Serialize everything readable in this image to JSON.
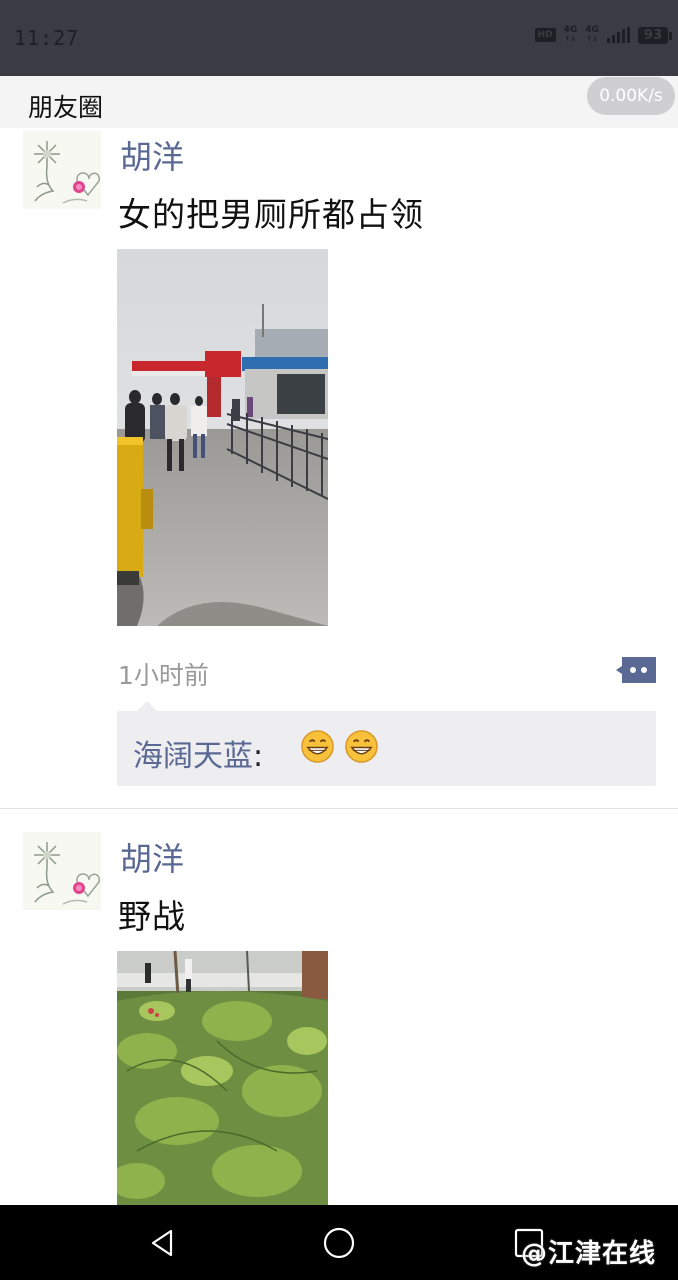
{
  "status_bar": {
    "time": "11:27",
    "hd": "HD",
    "net1": "4G",
    "net2": "4G",
    "battery": "93"
  },
  "header": {
    "title": "朋友圈",
    "speed": "0.00K/s"
  },
  "posts": [
    {
      "author": "胡洋",
      "text": "女的把男厕所都占领",
      "time_ago": "1小时前",
      "comments": [
        {
          "commenter": "海阔天蓝",
          "colon": ":",
          "emojis": [
            "grinning-emoji",
            "grinning-emoji"
          ]
        }
      ]
    },
    {
      "author": "胡洋",
      "text": "野战"
    }
  ],
  "nav_bar": {
    "icons": [
      "back-icon",
      "home-icon",
      "recents-icon"
    ],
    "watermark": "@江津在线"
  },
  "colors": {
    "status_bg": "#3a3b43",
    "header_bg": "#f4f4f5",
    "author_blue": "#5a6894",
    "comment_bg": "#eeeef0"
  }
}
